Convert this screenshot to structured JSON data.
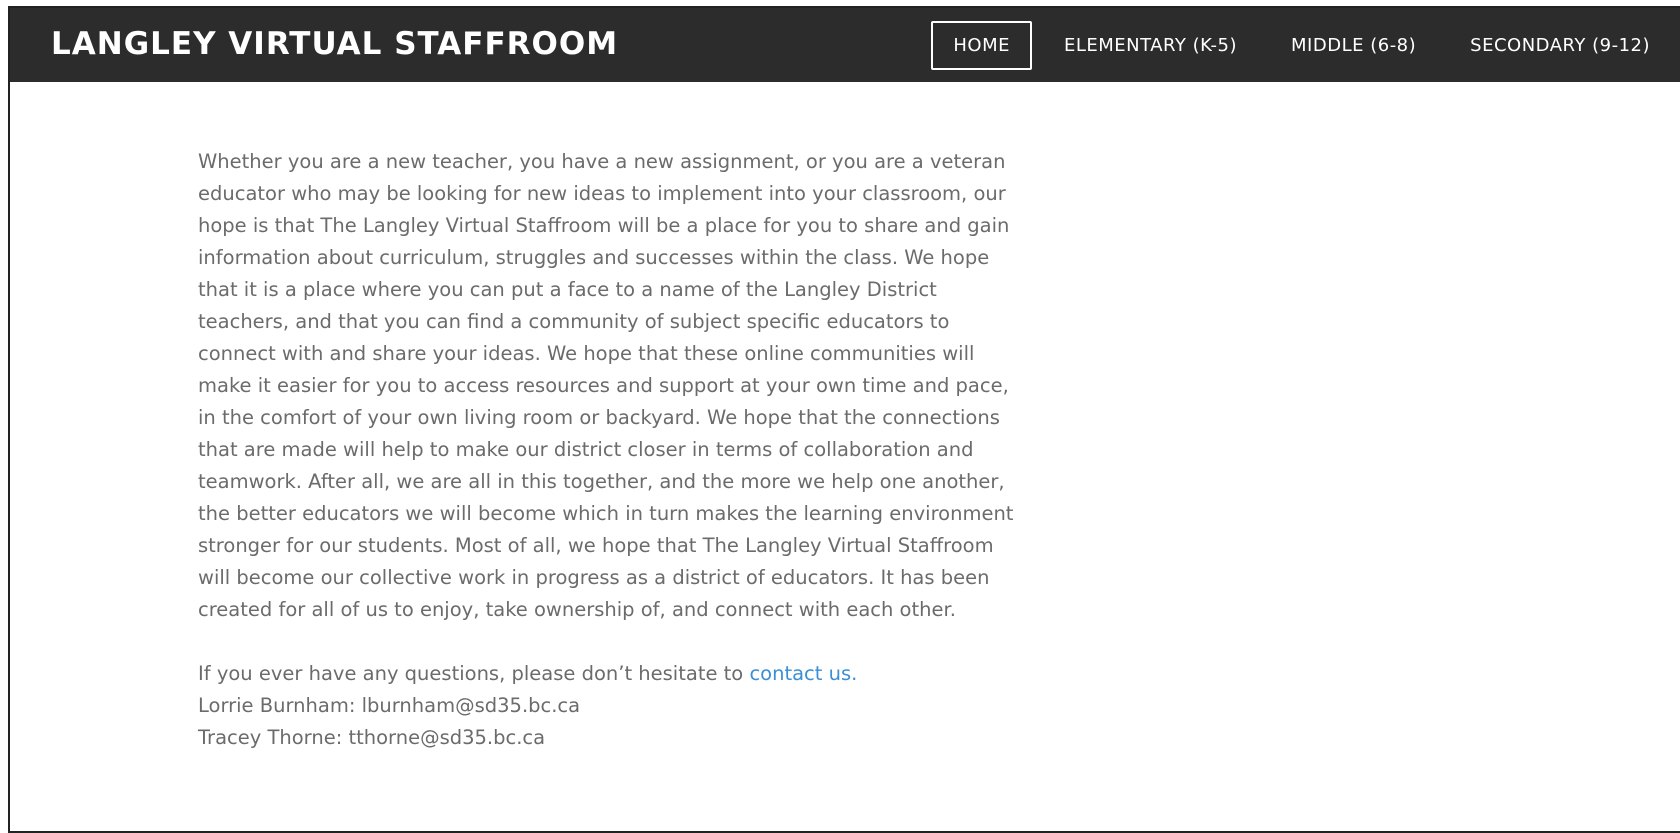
{
  "site": {
    "title": "LANGLEY VIRTUAL STAFFROOM"
  },
  "nav": {
    "items": [
      {
        "label": "HOME",
        "active": true
      },
      {
        "label": "ELEMENTARY (K-5)",
        "active": false
      },
      {
        "label": "MIDDLE (6-8)",
        "active": false
      },
      {
        "label": "SECONDARY (9-12)",
        "active": false
      }
    ]
  },
  "main": {
    "intro": "Whether you are a new teacher, you have a new assignment, or you are a veteran educator who may be looking for new ideas to implement into your classroom, our hope is that The Langley Virtual Staffroom will be a place for you to share and gain information about curriculum, struggles and successes within the class. We hope that it is a place where you can put a face to a name of the Langley District teachers, and that you can find a community of subject specific educators to connect with and share your ideas.  We hope that these online communities will make it easier for you to access resources and support at your own time and pace, in the comfort of your own living room or backyard. We hope that the connections that are made will help to make our district closer in terms of collaboration and teamwork. After all, we are all in this together, and the more we help one another, the better educators we will become which in turn makes the learning environment stronger for our students. Most of all, we hope that The Langley Virtual Staffroom will become our collective work in progress as a district of educators. It has been created for all of us to enjoy, take ownership of, and connect with each other.",
    "questions_text": "If you ever have any questions, please don’t hesitate to ",
    "contact_link": "contact us.",
    "contacts": [
      "Lorrie Burnham: lburnham@sd35.bc.ca",
      "Tracey Thorne: tthorne@sd35.bc.ca"
    ]
  },
  "colors": {
    "header_bg": "#2c2c2c",
    "body_text": "#6b6b6b",
    "link": "#3a8fd6"
  }
}
